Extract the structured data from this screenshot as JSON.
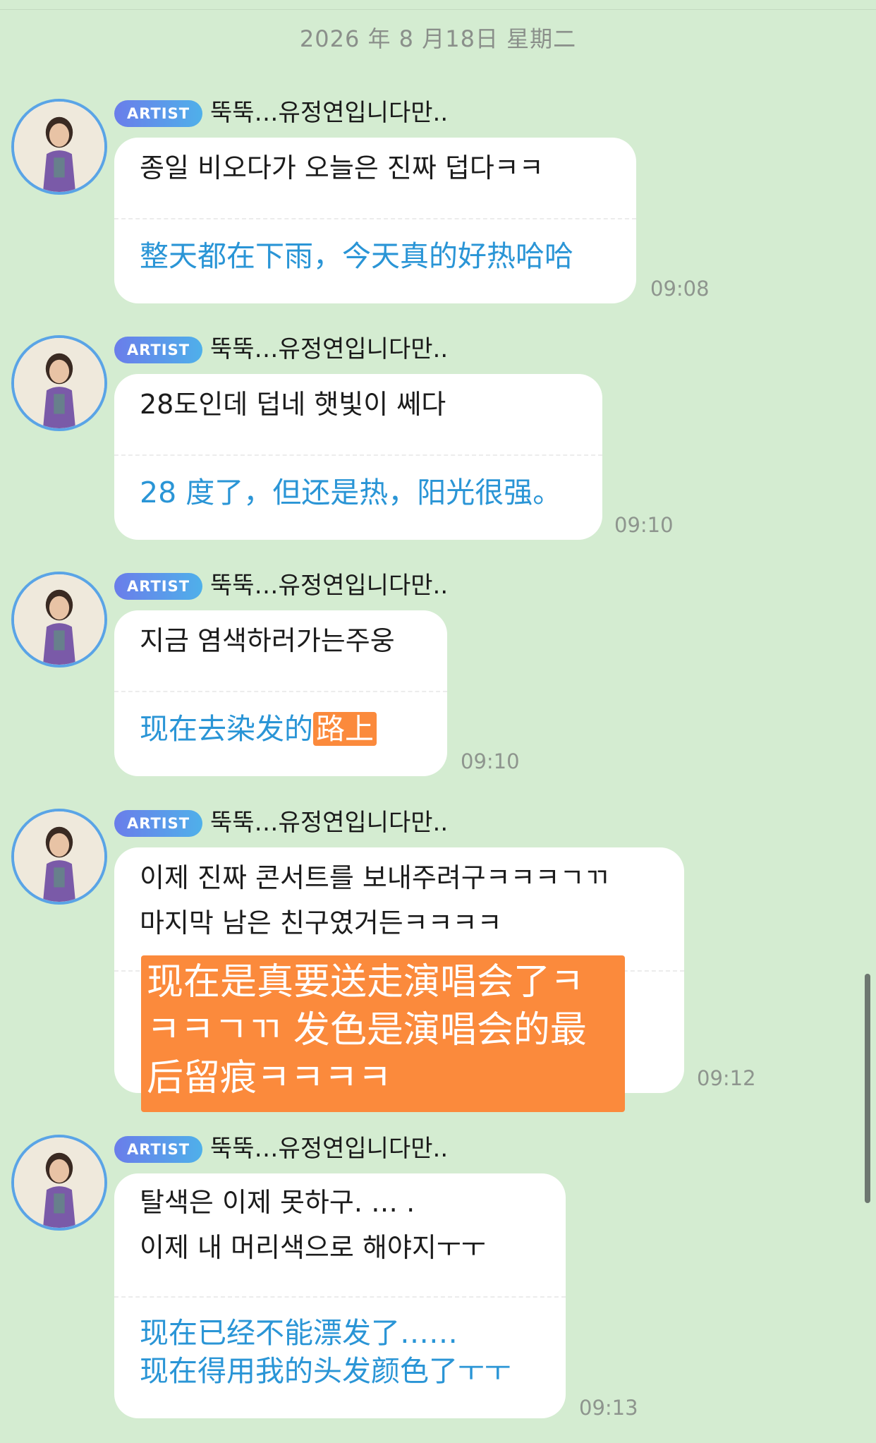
{
  "date_header": "2026 年 8 月18日 星期二",
  "artist_badge": "ARTIST",
  "sender_name": "뚝뚝…유정연입니다만..",
  "messages": [
    {
      "ko": [
        "종일 비오다가 오늘은 진짜 덥다ㅋㅋ"
      ],
      "zh": [
        "整天都在下雨，今天真的好热哈哈"
      ],
      "time": "09:08"
    },
    {
      "ko": [
        "28도인데 덥네 햇빛이 쎄다"
      ],
      "zh": [
        "28 度了，但还是热，阳光很强。"
      ],
      "time": "09:10"
    },
    {
      "ko": [
        "지금 염색하러가는주웅"
      ],
      "zh_plain": "现在去染发的",
      "zh_highlight": "路上",
      "time": "09:10"
    },
    {
      "ko": [
        "이제 진짜 콘서트를 보내주려구ㅋㅋㅋㄱㄲ",
        "마지막 남은 친구였거든ㅋㅋㅋㅋ"
      ],
      "zh": [
        "现在是真要送走演唱会了ㅋ",
        "ㅋㅋㄱㄲ 发色是演唱会的最",
        "后留痕ㅋㅋㅋㅋ"
      ],
      "time": "09:12"
    },
    {
      "ko": [
        "탈색은 이제 못하구. … .",
        "이제 내 머리색으로 해야지ㅜㅜ"
      ],
      "zh": [
        "现在已经不能漂发了……",
        "现在得用我的头发颜色了ㅜㅜ"
      ],
      "time": "09:13"
    }
  ]
}
